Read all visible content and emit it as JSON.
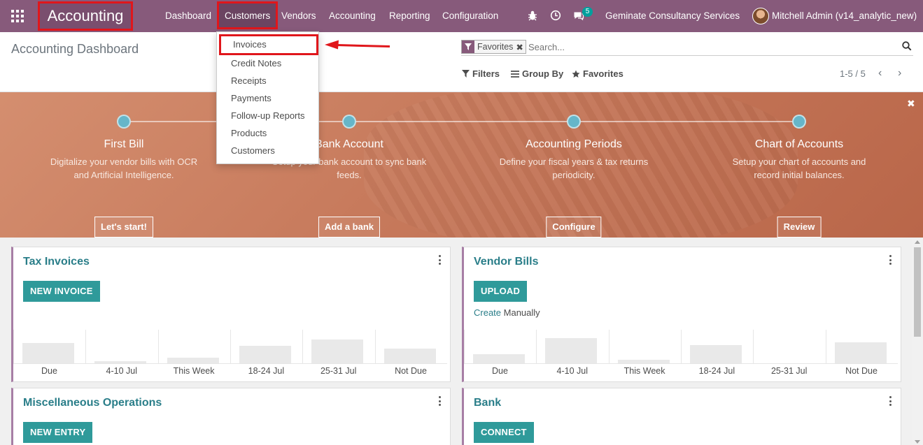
{
  "navbar": {
    "app_name": "Accounting",
    "menu": [
      "Dashboard",
      "Customers",
      "Vendors",
      "Accounting",
      "Reporting",
      "Configuration"
    ],
    "messages_count": "5",
    "company": "Geminate Consultancy Services",
    "user": "Mitchell Admin (v14_analytic_new)",
    "icons": [
      "apps-icon",
      "bug-icon",
      "clock-icon",
      "chat-icon"
    ]
  },
  "customers_menu": {
    "items": [
      "Invoices",
      "Credit Notes",
      "Receipts",
      "Payments",
      "Follow-up Reports",
      "Products",
      "Customers"
    ],
    "highlighted": "Invoices"
  },
  "control_panel": {
    "title": "Accounting Dashboard",
    "facet_label": "Favorites",
    "search_placeholder": "Search...",
    "filters_label": "Filters",
    "groupby_label": "Group By",
    "favorites_label": "Favorites",
    "pager": "1-5 / 5"
  },
  "onboarding": {
    "steps": [
      {
        "title": "First Bill",
        "desc": "Digitalize your vendor bills with OCR and Artificial Intelligence.",
        "button": "Let's start!"
      },
      {
        "title": "Bank Account",
        "desc": "Setup your bank account to sync bank feeds.",
        "button": "Add a bank"
      },
      {
        "title": "Accounting Periods",
        "desc": "Define your fiscal years & tax returns periodicity.",
        "button": "Configure"
      },
      {
        "title": "Chart of Accounts",
        "desc": "Setup your chart of accounts and record initial balances.",
        "button": "Review"
      }
    ],
    "close_label": "✖"
  },
  "cards": {
    "tax_invoices": {
      "title": "Tax Invoices",
      "button": "NEW INVOICE",
      "graph": {
        "labels": [
          "Due",
          "4-10 Jul",
          "This Week",
          "18-24 Jul",
          "25-31 Jul",
          "Not Due"
        ],
        "values": [
          0.68,
          0.06,
          0.18,
          0.6,
          0.8,
          0.5
        ]
      }
    },
    "vendor_bills": {
      "title": "Vendor Bills",
      "button": "UPLOAD",
      "create_link": "Create",
      "create_rest": " Manually",
      "graph": {
        "labels": [
          "Due",
          "4-10 Jul",
          "This Week",
          "18-24 Jul",
          "25-31 Jul",
          "Not Due"
        ],
        "values": [
          0.3,
          0.86,
          0.12,
          0.62,
          0.0,
          0.72
        ]
      }
    },
    "misc": {
      "title": "Miscellaneous Operations",
      "button": "NEW ENTRY"
    },
    "bank": {
      "title": "Bank",
      "button": "CONNECT"
    }
  },
  "colors": {
    "primary": "#875a7b",
    "accent": "#2f9a9a",
    "highlight": "#e0161b"
  }
}
